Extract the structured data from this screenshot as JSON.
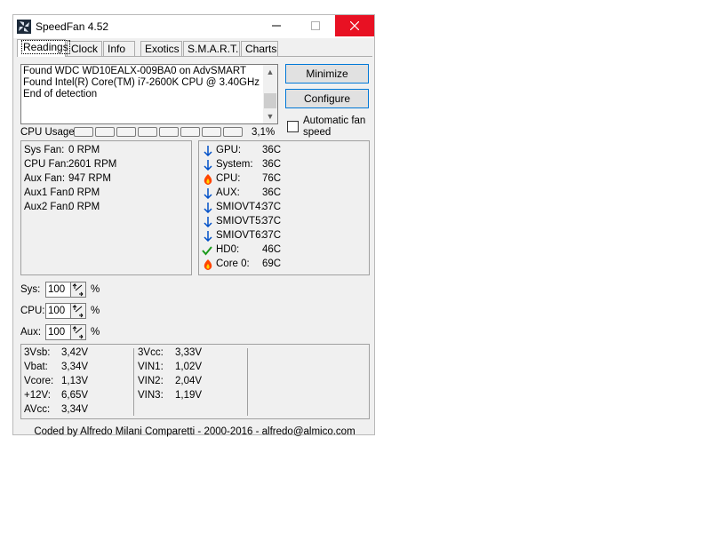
{
  "window": {
    "title": "SpeedFan 4.52"
  },
  "tabs": [
    {
      "label": "Readings"
    },
    {
      "label": "Clock"
    },
    {
      "label": "Info"
    },
    {
      "label": "Exotics"
    },
    {
      "label": "S.M.A.R.T."
    },
    {
      "label": "Charts"
    }
  ],
  "log": {
    "lines": [
      "Found WDC WD10EALX-009BA0 on AdvSMART",
      "Found Intel(R) Core(TM) i7-2600K CPU @ 3.40GHz",
      "End of detection"
    ]
  },
  "buttons": {
    "minimize": "Minimize",
    "configure": "Configure"
  },
  "auto_fan": {
    "label": "Automatic fan speed",
    "checked": false
  },
  "cpu_usage": {
    "label": "CPU Usage",
    "value": "3,1%",
    "segments": 8
  },
  "fans": [
    {
      "name": "Sys Fan:",
      "value": "0 RPM"
    },
    {
      "name": "CPU Fan:",
      "value": "2601 RPM"
    },
    {
      "name": "Aux Fan:",
      "value": "947 RPM"
    },
    {
      "name": "Aux1 Fan:",
      "value": "0 RPM"
    },
    {
      "name": "Aux2 Fan:",
      "value": "0 RPM"
    }
  ],
  "temps": [
    {
      "name": "GPU:",
      "value": "36C",
      "icon": "arrow-down-icon"
    },
    {
      "name": "System:",
      "value": "36C",
      "icon": "arrow-down-icon"
    },
    {
      "name": "CPU:",
      "value": "76C",
      "icon": "flame-icon"
    },
    {
      "name": "AUX:",
      "value": "36C",
      "icon": "arrow-down-icon"
    },
    {
      "name": "SMIOVT4:",
      "value": "37C",
      "icon": "arrow-down-icon"
    },
    {
      "name": "SMIOVT5:",
      "value": "37C",
      "icon": "arrow-down-icon"
    },
    {
      "name": "SMIOVT6:",
      "value": "37C",
      "icon": "arrow-down-icon"
    },
    {
      "name": "HD0:",
      "value": "46C",
      "icon": "checkmark-icon"
    },
    {
      "name": "Core 0:",
      "value": "69C",
      "icon": "flame-icon"
    }
  ],
  "speed_controls": [
    {
      "label": "Sys:",
      "value": "100",
      "unit": "%"
    },
    {
      "label": "CPU:",
      "value": "100",
      "unit": "%"
    },
    {
      "label": "Aux:",
      "value": "100",
      "unit": "%"
    }
  ],
  "voltages_col1": [
    {
      "name": "3Vsb:",
      "value": "3,42V"
    },
    {
      "name": "Vbat:",
      "value": "3,34V"
    },
    {
      "name": "Vcore:",
      "value": "1,13V"
    },
    {
      "name": "+12V:",
      "value": "6,65V"
    },
    {
      "name": "AVcc:",
      "value": "3,34V"
    }
  ],
  "voltages_col2": [
    {
      "name": "3Vcc:",
      "value": "3,33V"
    },
    {
      "name": "VIN1:",
      "value": "1,02V"
    },
    {
      "name": "VIN2:",
      "value": "2,04V"
    },
    {
      "name": "VIN3:",
      "value": "1,19V"
    }
  ],
  "footer": "Coded by Alfredo Milani Comparetti - 2000-2016 - alfredo@almico.com",
  "colors": {
    "close": "#e81123",
    "arrow": "#0050c8",
    "flame": "#ff4500",
    "check": "#1a9a1a",
    "focus": "#0078d7"
  }
}
